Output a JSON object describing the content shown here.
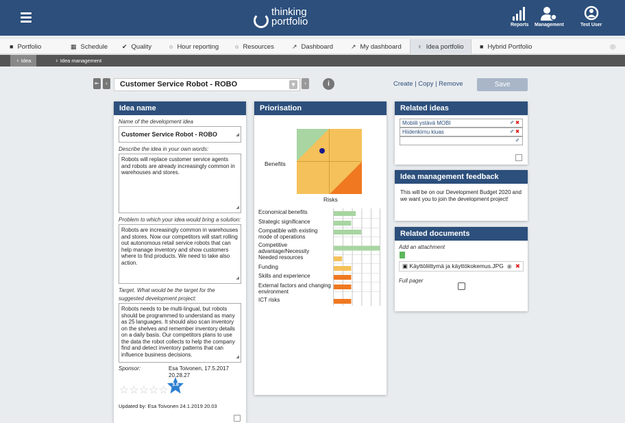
{
  "topbar": {
    "logo_line1": "thinking",
    "logo_line2": "portfolio",
    "nav": [
      {
        "label": "Reports",
        "icon": "bar-chart-icon"
      },
      {
        "label": "Management",
        "icon": "users-gear-icon"
      },
      {
        "label": "Test User",
        "icon": "user-icon"
      }
    ]
  },
  "tabs": [
    {
      "label": "Portfolio",
      "icon": "briefcase-icon"
    },
    {
      "label": "Schedule",
      "icon": "calendar-icon"
    },
    {
      "label": "Quality",
      "icon": "check-icon"
    },
    {
      "label": "Hour reporting",
      "icon": "clock-icon"
    },
    {
      "label": "Resources",
      "icon": "person-icon"
    },
    {
      "label": "Dashboard",
      "icon": "line-chart-icon"
    },
    {
      "label": "My dashboard",
      "icon": "line-chart-icon"
    },
    {
      "label": "Idea portfolio",
      "icon": "lightbulb-icon",
      "active": true
    },
    {
      "label": "Hybrid Portfolio",
      "icon": "briefcase-icon"
    }
  ],
  "subnav": {
    "idea": "Idea",
    "idea_management": "Idea management"
  },
  "toolbar": {
    "selected_idea": "Customer Service Robot - ROBO",
    "actions": "Create | Copy | Remove",
    "save": "Save"
  },
  "idea": {
    "header": "Idea name",
    "name_label": "Name of the development idea",
    "name_value": "Customer Service Robot - ROBO",
    "describe_label": "Describe the idea in your own words:",
    "describe_value": "Robots will replace customer service agents and robots are already increasingly common in warehouses and stores.",
    "problem_label": "Problem to which your idea would bring a solution:",
    "problem_value": "Robots are increasingly common in warehouses and stores. Now our competitors  will start rolling out autonomous retail service robots that can help manage inventory and show customers where to find products. We need to take also action.",
    "target_label_1": "Target. What would be the target for the",
    "target_label_2": "suggested development project:",
    "target_value": "Robots needs to be multi-lingual, but robots should be programmed to understand as many as 25 languages. It should also scan inventory on the shelves and remember inventory details on a daily basis. Our competitors plans to use the data the robot collects to help the company find and detect inventory patterns that can influence business decisions.",
    "sponsor_label": "Sponsor:",
    "sponsor_value_1": "Esa Toivonen, 17.5.2017",
    "sponsor_value_2": "20.28.27",
    "rating": "3.6",
    "stars_max": 5,
    "updated": "Updated by: Esa Toivonen 24.1.2019 20.03"
  },
  "priorisation": {
    "header": "Priorisation",
    "y_label": "Benefits",
    "x_label": "Risks",
    "criteria": [
      {
        "label": "Economical benefits",
        "value": 0.48,
        "color": "#a8d5a2"
      },
      {
        "label": "Strategic significance",
        "value": 0.38,
        "color": "#a8d5a2"
      },
      {
        "label": "Compatible with existing mode of operations",
        "value": 0.6,
        "color": "#a8d5a2"
      },
      {
        "label": "Competitive advantage/Necessity",
        "value": 1.0,
        "color": "#a8d5a2"
      },
      {
        "label": "Needed resources",
        "value": 0.18,
        "color": "#f5c15a"
      },
      {
        "label": "Funding",
        "value": 0.38,
        "color": "#f5c15a"
      },
      {
        "label": "Skills and experience",
        "value": 0.38,
        "color": "#f07820"
      },
      {
        "label": "External factors and changing environment",
        "value": 0.38,
        "color": "#f07820"
      },
      {
        "label": "ICT risks",
        "value": 0.38,
        "color": "#f07820"
      }
    ]
  },
  "related_ideas": {
    "header": "Related ideas",
    "items": [
      "Mobiili ystävä MOBI",
      "Hiidenkirnu kiuas"
    ]
  },
  "feedback": {
    "header": "Idea management feedback",
    "text": "This will be on our Development Budget 2020 and we want you to join the development project!"
  },
  "documents": {
    "header": "Related documents",
    "add_label": "Add an attachment",
    "file": "Käyttöliittymä ja käyttökokemus.JPG",
    "full_pager": "Full pager"
  },
  "colors": {
    "header": "#2c4f7c",
    "green": "#a8d5a2",
    "yellow": "#f5c15a",
    "orange": "#f07820",
    "dot": "#1a1a8c"
  }
}
